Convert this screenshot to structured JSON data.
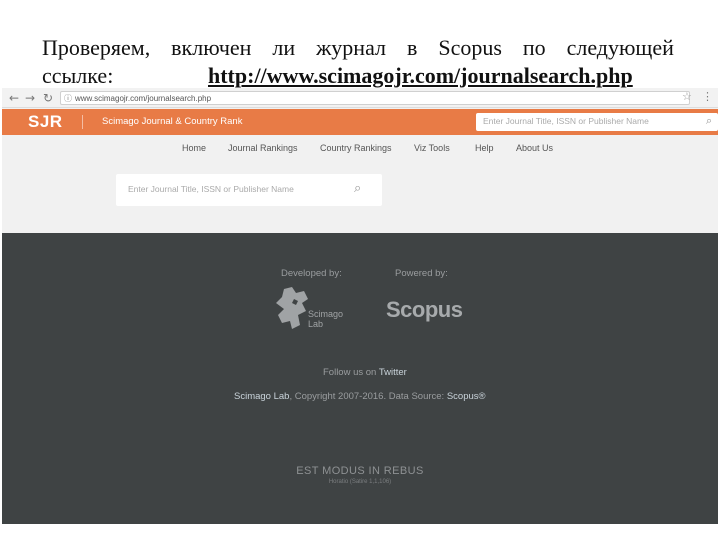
{
  "slide": {
    "title_words": [
      "Проверяем,",
      "включен",
      "ли",
      "журнал",
      "в",
      "Scopus",
      "по",
      "следующей"
    ],
    "line2_label": "ссылке:",
    "link_text": "http://www.scimagojr.com/journalsearch.php"
  },
  "browser": {
    "back_icon": "←",
    "forward_icon": "→",
    "reload_icon": "↻",
    "info_icon": "ⓘ",
    "url": "www.scimagojr.com/journalsearch.php",
    "star_icon": "☆",
    "menu_icon": "⋮"
  },
  "header": {
    "logo": "SJR",
    "subtitle": "Scimago Journal & Country Rank",
    "search_placeholder": "Enter Journal Title, ISSN or Publisher Name",
    "search_icon": "⌕",
    "color": "#e87b46"
  },
  "nav": {
    "items": [
      "Home",
      "Journal Rankings",
      "Country Rankings",
      "Viz Tools",
      "Help",
      "About Us"
    ]
  },
  "main": {
    "search_placeholder": "Enter Journal Title, ISSN or Publisher Name",
    "search_icon": "⌕"
  },
  "footer": {
    "developed_by": "Developed by:",
    "powered_by": "Powered by:",
    "scimago_line1": "Scimago",
    "scimago_line2": "Lab",
    "scopus": "Scopus",
    "follow_prefix": "Follow us on",
    "follow_link": "Twitter",
    "copyright_link": "Scimago Lab",
    "copyright_text": ", Copyright 2007-2016. Data Source:",
    "data_source_link": "Scopus®",
    "motto": "EST MODUS IN REBUS",
    "motto_sub": "Horatio (Satire 1,1,106)",
    "background": "#3f4344"
  }
}
